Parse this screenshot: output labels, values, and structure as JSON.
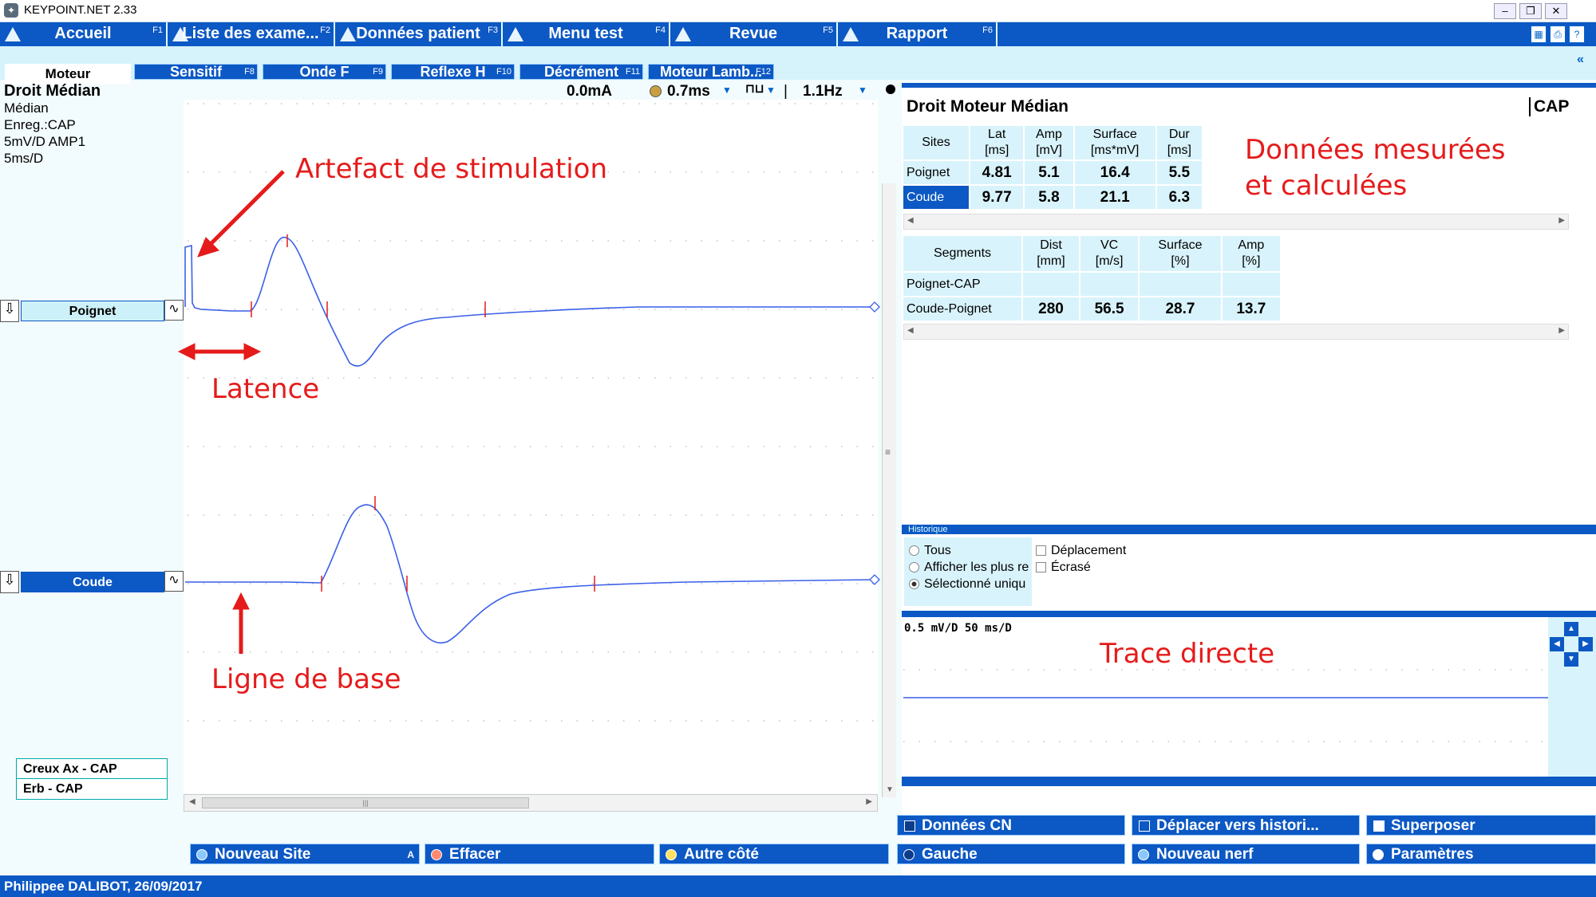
{
  "window": {
    "title": "KEYPOINT.NET 2.33"
  },
  "menu": [
    {
      "label": "Accueil",
      "fkey": "F1"
    },
    {
      "label": "Liste des exame...",
      "fkey": "F2"
    },
    {
      "label": "Données patient",
      "fkey": "F3"
    },
    {
      "label": "Menu test",
      "fkey": "F4"
    },
    {
      "label": "Revue",
      "fkey": "F5"
    },
    {
      "label": "Rapport",
      "fkey": "F6"
    }
  ],
  "subtabs": [
    {
      "label": "Moteur",
      "fkey": ""
    },
    {
      "label": "Sensitif",
      "fkey": "F8"
    },
    {
      "label": "Onde F",
      "fkey": "F9"
    },
    {
      "label": "Reflexe H",
      "fkey": "F10"
    },
    {
      "label": "Décrément",
      "fkey": "F11"
    },
    {
      "label": "Moteur Lamb...",
      "fkey": "F12"
    }
  ],
  "left_info": {
    "title": "Droit Médian",
    "nerve": "Médian",
    "record": "Enreg.:CAP",
    "gain": "5mV/D  AMP1",
    "sweep": "5ms/D"
  },
  "controls": {
    "intensity": "0.0mA",
    "duration": "0.7ms",
    "frequency": "1.1Hz"
  },
  "traces": [
    {
      "label": "Poignet"
    },
    {
      "label": "Coude"
    }
  ],
  "other_sites": [
    "Creux Ax - CAP",
    "Erb - CAP"
  ],
  "annotations": {
    "artefact": "Artefact de stimulation",
    "latence": "Latence",
    "baseline": "Ligne de base",
    "donnees_1": "Données mesurées",
    "donnees_2": "et calculées",
    "trace": "Trace directe"
  },
  "panel": {
    "title": "Droit Moteur Médian",
    "cap": "CAP"
  },
  "sites_table": {
    "headers": [
      "Sites",
      "Lat\n[ms]",
      "Amp\n[mV]",
      "Surface\n[ms*mV]",
      "Dur\n[ms]"
    ],
    "rows": [
      [
        "Poignet",
        "4.81",
        "5.1",
        "16.4",
        "5.5"
      ],
      [
        "Coude",
        "9.77",
        "5.8",
        "21.1",
        "6.3"
      ]
    ]
  },
  "segments_table": {
    "headers": [
      "Segments",
      "Dist\n[mm]",
      "VC\n[m/s]",
      "Surface\n[%]",
      "Amp\n[%]"
    ],
    "rows": [
      [
        "Poignet-CAP",
        "",
        "",
        "",
        ""
      ],
      [
        "Coude-Poignet",
        "280",
        "56.5",
        "28.7",
        "13.7"
      ]
    ]
  },
  "history": {
    "header": "Historique",
    "radios": [
      "Tous",
      "Afficher les plus re",
      "Sélectionné uniqu"
    ],
    "selected": 2,
    "checks": [
      "Déplacement",
      "Écrasé"
    ]
  },
  "direct_trace": {
    "scale": "0.5 mV/D 50 ms/D"
  },
  "buttons": {
    "donnees_cn": "Données CN",
    "deplacer": "Déplacer vers histori...",
    "superposer": "Superposer",
    "nouveau_site": "Nouveau Site",
    "nouveau_site_key": "A",
    "effacer": "Effacer",
    "autre_cote": "Autre côté",
    "gauche": "Gauche",
    "nouveau_nerf": "Nouveau nerf",
    "parametres": "Paramètres"
  },
  "status": "Philippee DALIBOT, 26/09/2017"
}
